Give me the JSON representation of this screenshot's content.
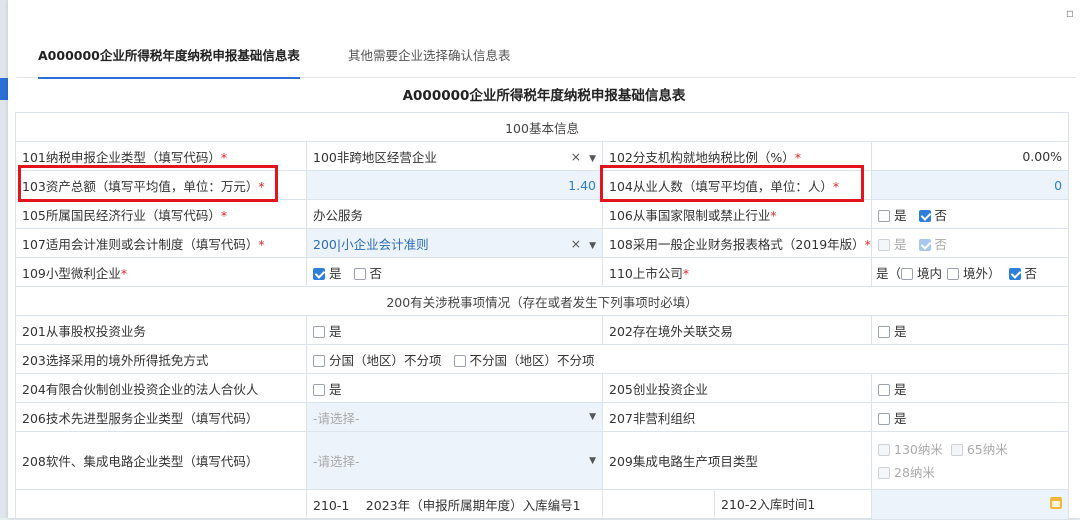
{
  "tabs": [
    {
      "label": "A000000企业所得税年度纳税申报基础信息表",
      "active": true
    },
    {
      "label": "其他需要企业选择确认信息表",
      "active": false
    }
  ],
  "form_title": "A000000企业所得税年度纳税申报基础信息表",
  "sections": {
    "s100": "100基本信息",
    "s200": "200有关涉税事项情况（存在或者发生下列事项时必填）"
  },
  "rows": {
    "r101": {
      "label": "101纳税申报企业类型（填写代码）",
      "value": "100非跨地区经营企业"
    },
    "r102": {
      "label": "102分支机构就地纳税比例（%）",
      "value": "0.00%"
    },
    "r103": {
      "label": "103资产总额（填写平均值，单位：万元）",
      "value": "1.40"
    },
    "r104": {
      "label": "104从业人数（填写平均值，单位：人）",
      "value": "0"
    },
    "r105": {
      "label": "105所属国民经济行业（填写代码）",
      "value": "办公服务"
    },
    "r106": {
      "label": "106从事国家限制或禁止行业",
      "yes": "是",
      "no": "否"
    },
    "r107": {
      "label": "107适用会计准则或会计制度（填写代码）",
      "value": "200|小企业会计准则"
    },
    "r108": {
      "label": "108采用一般企业财务报表格式（2019年版）",
      "yes": "是",
      "no": "否"
    },
    "r109": {
      "label": "109小型微利企业",
      "yes": "是",
      "no": "否"
    },
    "r110": {
      "label": "110上市公司",
      "prefix": "是（",
      "in": "境内",
      "out": "境外）",
      "no": "否"
    },
    "r201": {
      "label": "201从事股权投资业务",
      "yes": "是"
    },
    "r202": {
      "label": "202存在境外关联交易",
      "yes": "是"
    },
    "r203": {
      "label": "203选择采用的境外所得抵免方式",
      "opt1": "分国（地区）不分项",
      "opt2": "不分国（地区）不分项"
    },
    "r204": {
      "label": "204有限合伙制创业投资企业的法人合伙人",
      "yes": "是"
    },
    "r205": {
      "label": "205创业投资企业",
      "yes": "是"
    },
    "r206": {
      "label": "206技术先进型服务企业类型（填写代码）",
      "placeholder": "-请选择-"
    },
    "r207": {
      "label": "207非营利组织",
      "yes": "是"
    },
    "r208": {
      "label": "208软件、集成电路企业类型（填写代码）",
      "placeholder": "-请选择-"
    },
    "r209": {
      "label": "209集成电路生产项目类型",
      "opt1": "130纳米",
      "opt2": "65纳米",
      "opt3": "28纳米"
    },
    "r210_1": {
      "label": "210-1　 2023年（申报所属期年度）入库编号1"
    },
    "r210_2": {
      "label": "210-2入库时间1"
    }
  },
  "symbols": {
    "required": "*",
    "clear": "×",
    "caret": "▼"
  },
  "colors": {
    "accent": "#2c6fd4",
    "highlight": "#e3141b"
  }
}
